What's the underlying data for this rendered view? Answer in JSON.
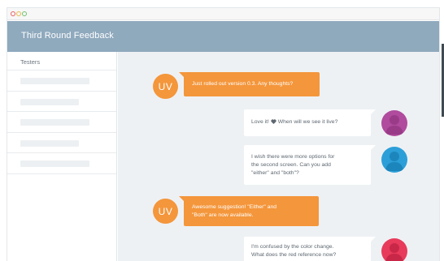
{
  "window": {
    "title": "Third Round Feedback"
  },
  "sidebar": {
    "header": "Testers",
    "rows": [
      {
        "placeholder_fraction": 0.63
      },
      {
        "placeholder_fraction": 0.53
      },
      {
        "placeholder_fraction": 0.63
      },
      {
        "placeholder_fraction": 0.53
      },
      {
        "placeholder_fraction": 0.63
      }
    ]
  },
  "messages": [
    {
      "sender": "UV",
      "direction": "out",
      "text": "Just rolled out version 0.3. Any thoughts?"
    },
    {
      "direction": "in",
      "text_before_icon": "Love it!",
      "icon": "heart-icon",
      "text_after_icon": "When will we see it live?",
      "avatar_color": "#b04b9d"
    },
    {
      "direction": "in",
      "lines": [
        "I wish there were more options for",
        "the second screen. Can you add",
        "\"either\" and \"both\"?"
      ],
      "avatar_color": "#2c9fd8"
    },
    {
      "sender": "UV",
      "direction": "out",
      "lines": [
        "Awesome suggestion! \"Either\" and",
        "\"Both\" are now available."
      ]
    },
    {
      "direction": "in",
      "lines": [
        "I'm confused by the color change.",
        "What does the red reference now?"
      ],
      "avatar_color": "#e83a5b"
    }
  ],
  "colors": {
    "accent": "#f4963b",
    "header": "#8fa9bd",
    "chat_bg": "#eef1f4"
  }
}
